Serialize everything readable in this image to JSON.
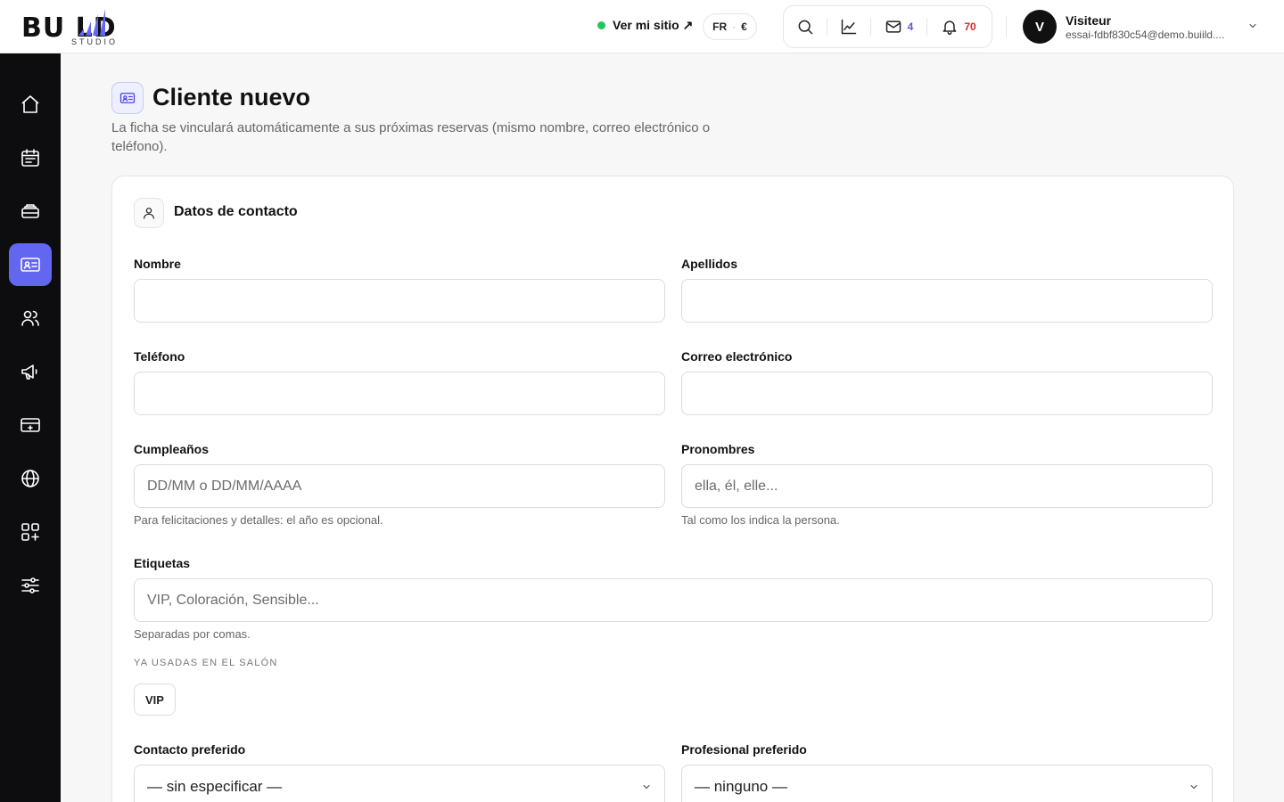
{
  "brand": {
    "name": "BU  LD",
    "sub": "STUDIO"
  },
  "header": {
    "site_link": "Ver mi sitio ↗",
    "lang": "FR",
    "currency": "€",
    "messages_count": "4",
    "notifications_count": "70",
    "user": {
      "initial": "V",
      "name": "Visiteur",
      "email": "essai-fdbf830c54@demo.buiild...."
    }
  },
  "sidebar": {
    "items": [
      {
        "icon": "home-icon"
      },
      {
        "icon": "calendar-icon"
      },
      {
        "icon": "inbox-stack-icon"
      },
      {
        "icon": "contact-card-icon",
        "active": true
      },
      {
        "icon": "users-icon"
      },
      {
        "icon": "megaphone-icon"
      },
      {
        "icon": "card-icon"
      },
      {
        "icon": "globe-icon"
      },
      {
        "icon": "apps-add-icon"
      },
      {
        "icon": "sliders-icon"
      }
    ]
  },
  "page": {
    "title": "Cliente nuevo",
    "description": "La ficha se vinculará automáticamente a sus próximas reservas (mismo nombre, correo electrónico o teléfono)."
  },
  "form": {
    "section_title": "Datos de contacto",
    "first_name": {
      "label": "Nombre",
      "value": ""
    },
    "last_name": {
      "label": "Apellidos",
      "value": ""
    },
    "phone": {
      "label": "Teléfono",
      "value": ""
    },
    "email": {
      "label": "Correo electrónico",
      "value": ""
    },
    "birthday": {
      "label": "Cumpleaños",
      "placeholder": "DD/MM o DD/MM/AAAA",
      "hint": "Para felicitaciones y detalles: el año es opcional."
    },
    "pronouns": {
      "label": "Pronombres",
      "placeholder": "ella, él, elle...",
      "hint": "Tal como los indica la persona."
    },
    "tags": {
      "label": "Etiquetas",
      "placeholder": "VIP, Coloración, Sensible...",
      "hint": "Separadas por comas.",
      "used_heading": "YA USADAS EN EL SALÓN",
      "used": [
        "VIP"
      ]
    },
    "preferred_contact": {
      "label": "Contacto preferido",
      "selected": "— sin especificar —"
    },
    "preferred_pro": {
      "label": "Profesional preferido",
      "selected": "— ninguno —"
    }
  },
  "colors": {
    "accent": "#6366f1",
    "online": "#22c55e",
    "alert": "#dc2626",
    "sidebar_bg": "#0d0d10"
  }
}
